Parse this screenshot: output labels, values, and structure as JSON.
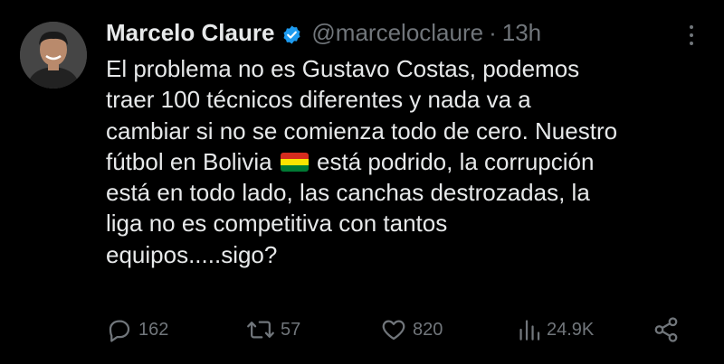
{
  "tweet": {
    "author": {
      "display_name": "Marcelo Claure",
      "handle": "@marceloclaure",
      "verified": true,
      "avatar_icon": "user-avatar"
    },
    "separator": "·",
    "time": "13h",
    "text_lines": [
      "El problema no es Gustavo Costas, podemos",
      "traer 100 técnicos diferentes y nada va a",
      "cambiar si no se comienza todo de cero. Nuestro",
      "fútbol en Bolivia",
      "está podrido, la corrupción",
      "está en todo lado, las canchas destrozadas, la",
      "liga no es competitiva con tantos",
      "equipos.....sigo?"
    ],
    "flag_emoji": "bolivia-flag",
    "actions": {
      "replies": "162",
      "reposts": "57",
      "likes": "820",
      "views": "24.9K"
    }
  },
  "colors": {
    "background": "#000000",
    "text": "#e7e9ea",
    "muted": "#71767b",
    "verified": "#1d9bf0"
  }
}
